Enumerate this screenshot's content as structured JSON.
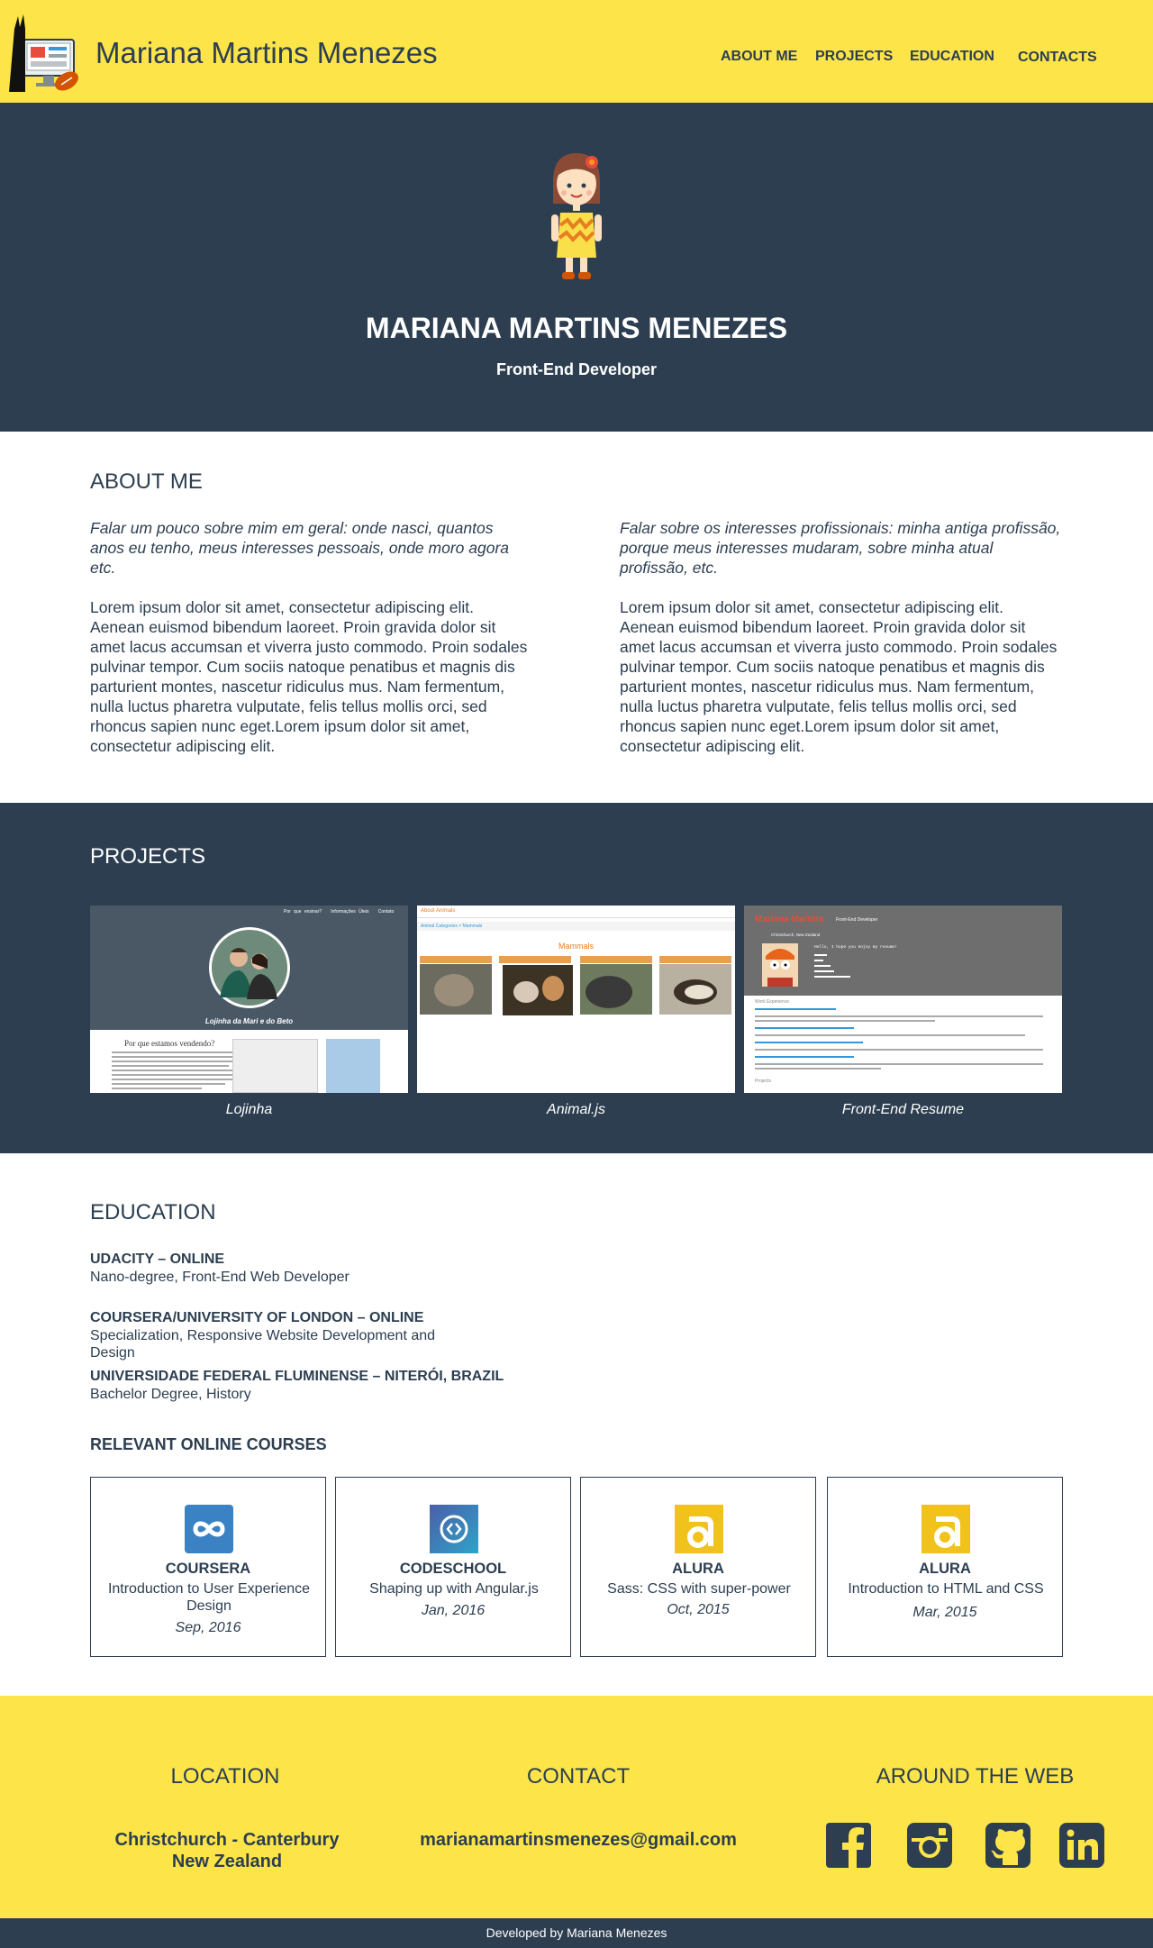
{
  "header": {
    "site_name": "Mariana Martins Menezes",
    "nav": [
      "ABOUT ME",
      "PROJECTS",
      "EDUCATION",
      "CONTACTS"
    ]
  },
  "hero": {
    "name": "MARIANA MARTINS MENEZES",
    "role": "Front-End Developer"
  },
  "about": {
    "title": "ABOUT ME",
    "columns": [
      {
        "intro": "Falar um pouco sobre mim em geral: onde nasci, quantos anos eu tenho, meus interesses pessoais, onde moro agora etc.",
        "body": "Lorem ipsum dolor sit amet, consectetur adipiscing elit. Aenean euismod bibendum laoreet. Proin gravida dolor sit amet lacus accumsan et viverra justo commodo. Proin sodales pulvinar tempor. Cum sociis natoque penatibus et magnis dis parturient montes, nascetur ridiculus mus. Nam fermentum, nulla luctus pharetra vulputate, felis tellus mollis orci, sed rhoncus sapien nunc eget.Lorem ipsum dolor sit amet, consectetur adipiscing elit."
      },
      {
        "intro": "Falar sobre os interesses profissionais: minha antiga profissão, porque meus interesses mudaram, sobre minha atual profissão, etc.",
        "body": "Lorem ipsum dolor sit amet, consectetur adipiscing elit. Aenean euismod bibendum laoreet. Proin gravida dolor sit amet lacus accumsan et viverra justo commodo. Proin sodales pulvinar tempor. Cum sociis natoque penatibus et magnis dis parturient montes, nascetur ridiculus mus. Nam fermentum, nulla luctus pharetra vulputate, felis tellus mollis orci, sed rhoncus sapien nunc eget.Lorem ipsum dolor sit amet, consectetur adipiscing elit."
      }
    ]
  },
  "projects": {
    "title": "PROJECTS",
    "items": [
      {
        "caption": "Lojinha",
        "thumb": {
          "nav": [
            "Por que ensinar?",
            "Informações Úteis",
            "Contato"
          ],
          "banner": "Lojinha da Mari e do Beto",
          "heading": "Por que estamos vendendo?"
        }
      },
      {
        "caption": "Animal.js",
        "thumb": {
          "top": "About Animals",
          "crumb": "Animal Categories  >  Mammals",
          "heading": "Mammals"
        }
      },
      {
        "caption": "Front-End Resume",
        "thumb": {
          "name": "Mariana Martins",
          "role": "Front-End Developer",
          "location": "Christchurch, New Zealand",
          "greeting": "Hello, I hope you enjoy my resume!",
          "section": "Work Experience",
          "footer_section": "Projects"
        }
      }
    ]
  },
  "education": {
    "title": "EDUCATION",
    "items": [
      {
        "school": "UDACITY – ONLINE",
        "degree": "Nano-degree, Front-End Web Developer"
      },
      {
        "school": "COURSERA/UNIVERSITY OF LONDON – ONLINE",
        "degree": "Specialization, Responsive Website Development and Design"
      },
      {
        "school": "UNIVERSIDADE FEDERAL FLUMINENSE – NITERÓI, BRAZIL",
        "degree": "Bachelor Degree, History"
      }
    ],
    "courses_title": "RELEVANT ONLINE COURSES",
    "courses": [
      {
        "provider": "COURSERA",
        "name": "Introduction to User Experience Design",
        "date": "Sep, 2016",
        "icon": "coursera-icon"
      },
      {
        "provider": "CODESCHOOL",
        "name": "Shaping up with Angular.js",
        "date": "Jan, 2016",
        "icon": "codeschool-icon"
      },
      {
        "provider": "ALURA",
        "name": "Sass: CSS with super-power",
        "date": "Oct, 2015",
        "icon": "alura-icon"
      },
      {
        "provider": "ALURA",
        "name": "Introduction to HTML and CSS",
        "date": "Mar, 2015",
        "icon": "alura-icon"
      }
    ]
  },
  "footer": {
    "location_title": "LOCATION",
    "location_line1": "Christchurch - Canterbury",
    "location_line2": "New Zealand",
    "contact_title": "CONTACT",
    "email": "marianamartinsmenezes@gmail.com",
    "web_title": "AROUND THE WEB",
    "social_icons": [
      "facebook-icon",
      "instagram-icon",
      "github-icon",
      "linkedin-icon"
    ],
    "credit": "Developed by Mariana Menezes"
  },
  "colors": {
    "yellow": "#fde549",
    "navy": "#2d3e50",
    "text": "#2c3e50"
  }
}
